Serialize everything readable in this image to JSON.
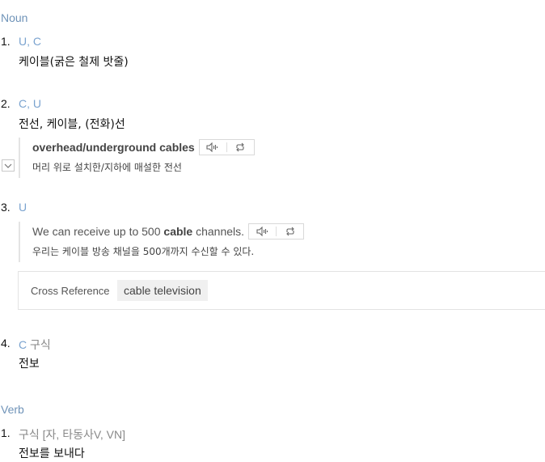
{
  "noun": {
    "label": "Noun",
    "senses": [
      {
        "num": "1.",
        "gram": "U, C",
        "def": "케이블(굵은 철제 밧줄)"
      },
      {
        "num": "2.",
        "gram": "C, U",
        "def": "전선, 케이블, (전화)선",
        "example": {
          "en_bold": "overhead/underground cables",
          "ko": "머리 위로 설치한/지하에 매설한 전선"
        }
      },
      {
        "num": "3.",
        "gram": "U",
        "example": {
          "en_pre": "We can receive up to 500 ",
          "en_bold": "cable",
          "en_post": " channels.",
          "ko": "우리는 케이블 방송 채널을 500개까지 수신할 수 있다."
        },
        "cross_reference": {
          "label": "Cross Reference",
          "link": "cable television"
        }
      },
      {
        "num": "4.",
        "gram": "C",
        "gram_extra": "구식",
        "def": "전보"
      }
    ]
  },
  "verb": {
    "label": "Verb",
    "senses": [
      {
        "num": "1.",
        "gram": "구식 [자, 타동사V, VN]",
        "def": "전보를 보내다"
      }
    ]
  },
  "icons": {
    "listen": "speaker-icon",
    "repeat": "repeat-icon",
    "expand": "chevron-down-icon"
  },
  "colors": {
    "pos_label": "#6f93b8",
    "gram_label": "#7aa3cf"
  }
}
